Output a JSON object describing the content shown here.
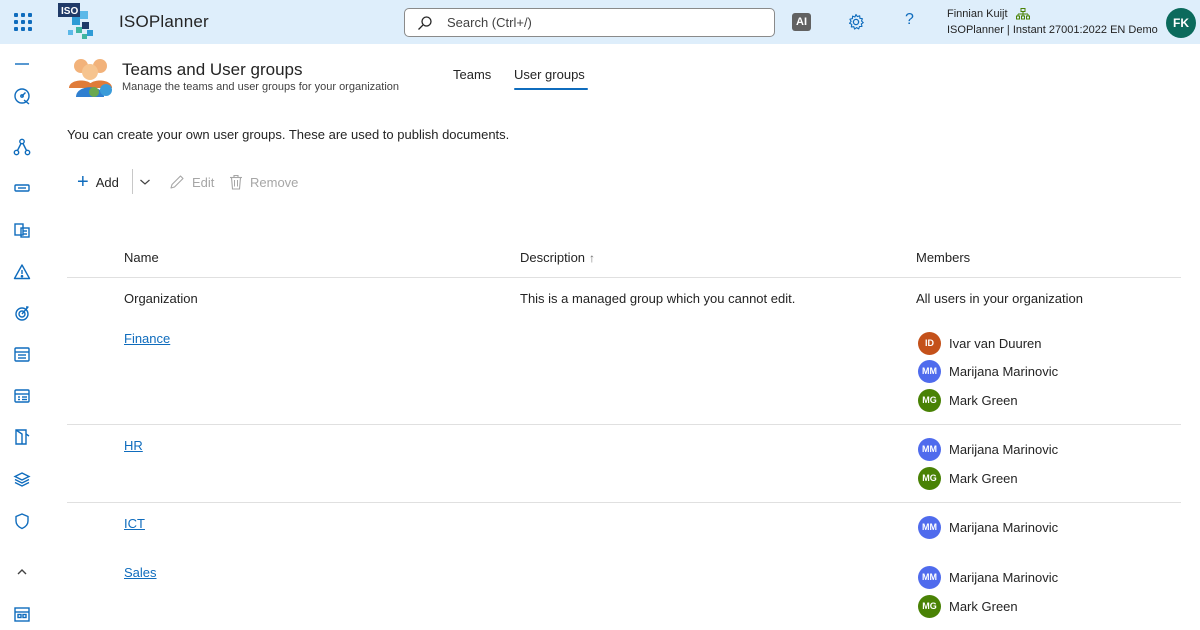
{
  "app": {
    "title": "ISOPlanner",
    "logo_text": "ISO"
  },
  "search": {
    "placeholder": "Search (Ctrl+/)"
  },
  "topbar": {
    "ai_label": "AI",
    "help_label": "?",
    "user_name": "Finnian Kuijt",
    "tenant": "ISOPlanner | Instant 27001:2022 EN Demo",
    "user_initials": "FK"
  },
  "header": {
    "title": "Teams and User groups",
    "subtitle": "Manage the teams and user groups for your organization"
  },
  "tabs": [
    {
      "label": "Teams",
      "active": false
    },
    {
      "label": "User groups",
      "active": true
    }
  ],
  "intro": "You can create your own user groups. These are used to publish documents.",
  "commands": {
    "add": "Add",
    "edit": "Edit",
    "remove": "Remove"
  },
  "table": {
    "columns": {
      "name": "Name",
      "description": "Description",
      "members": "Members"
    },
    "sort_indicator": "↑",
    "rows": [
      {
        "name": "Organization",
        "is_link": false,
        "description": "This is a managed group which you cannot edit.",
        "members_text": "All users in your organization",
        "members": []
      },
      {
        "name": "Finance",
        "is_link": true,
        "description": "",
        "members": [
          {
            "initials": "ID",
            "name": "Ivar van Duuren",
            "color": "#c4511a"
          },
          {
            "initials": "MM",
            "name": "Marijana Marinovic",
            "color": "#4f6bed"
          },
          {
            "initials": "MG",
            "name": "Mark Green",
            "color": "#498205"
          }
        ]
      },
      {
        "name": "HR",
        "is_link": true,
        "description": "",
        "members": [
          {
            "initials": "MM",
            "name": "Marijana Marinovic",
            "color": "#4f6bed"
          },
          {
            "initials": "MG",
            "name": "Mark Green",
            "color": "#498205"
          }
        ]
      },
      {
        "name": "ICT",
        "is_link": true,
        "description": "",
        "members": [
          {
            "initials": "MM",
            "name": "Marijana Marinovic",
            "color": "#4f6bed"
          }
        ]
      },
      {
        "name": "Sales",
        "is_link": true,
        "description": "",
        "members": [
          {
            "initials": "MM",
            "name": "Marijana Marinovic",
            "color": "#4f6bed"
          },
          {
            "initials": "MG",
            "name": "Mark Green",
            "color": "#498205"
          }
        ]
      }
    ]
  },
  "colors": {
    "accent": "#0f6cbd",
    "topbar_bg": "#deeefb",
    "avatar_user": "#0b6a5c"
  },
  "rail_icons": [
    "collapse-icon",
    "dashboard-icon",
    "process-icon",
    "assets-icon",
    "documents-icon",
    "risk-icon",
    "objectives-icon",
    "calendar-icon",
    "tasks-icon",
    "reports-icon",
    "library-icon",
    "controls-icon",
    "expand-up-icon",
    "settings-icon"
  ]
}
